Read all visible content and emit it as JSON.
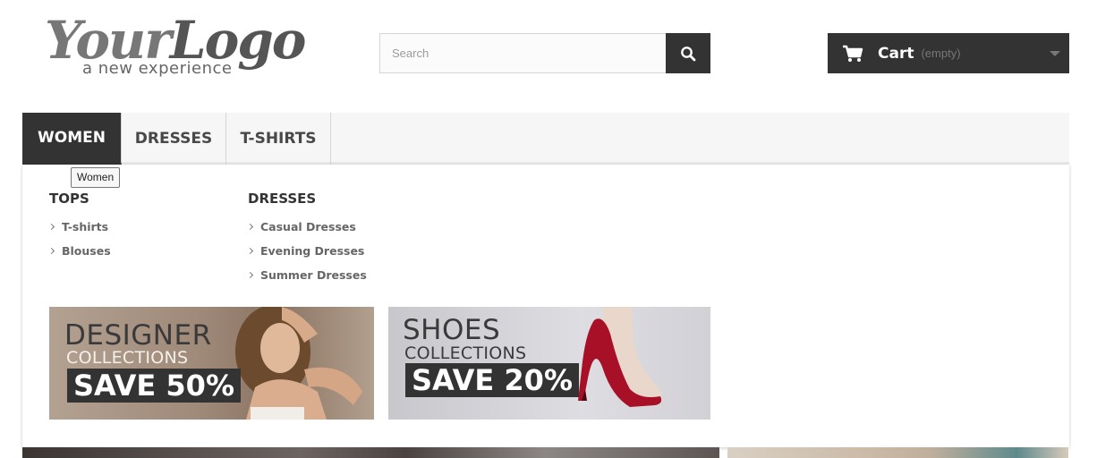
{
  "header": {
    "logo": {
      "main": "YourLogo",
      "part1": "Your",
      "part2": "Logo",
      "tagline": "a new experience"
    },
    "search": {
      "placeholder": "Search",
      "button_icon": "search-icon"
    },
    "cart": {
      "label": "Cart",
      "status": "(empty)",
      "icon": "cart-icon"
    }
  },
  "menu": {
    "items": [
      {
        "label": "WOMEN",
        "active": true
      },
      {
        "label": "DRESSES",
        "active": false
      },
      {
        "label": "T-SHIRTS",
        "active": false
      }
    ],
    "tooltip": "Women"
  },
  "dropdown": {
    "columns": [
      {
        "title": "TOPS",
        "links": [
          "T-shirts",
          "Blouses"
        ]
      },
      {
        "title": "DRESSES",
        "links": [
          "Casual Dresses",
          "Evening Dresses",
          "Summer Dresses"
        ]
      }
    ],
    "banners": [
      {
        "title": "DESIGNER",
        "subtitle": "COLLECTIONS",
        "offer": "SAVE 50%"
      },
      {
        "title": "SHOES",
        "subtitle": "COLLECTIONS",
        "offer": "SAVE 20%"
      }
    ]
  },
  "colors": {
    "dark": "#333333",
    "menu_bg": "#f6f6f6",
    "link": "#666666"
  }
}
